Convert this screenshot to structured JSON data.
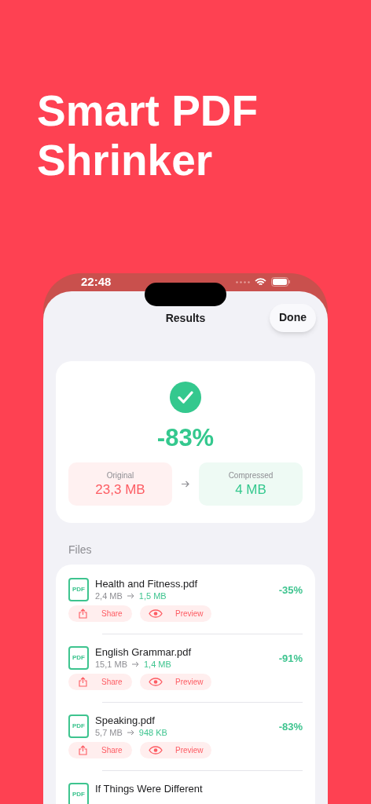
{
  "headline": "Smart PDF Shrinker",
  "status_bar": {
    "time": "22:48"
  },
  "sheet": {
    "title": "Results",
    "done_button": "Done"
  },
  "summary": {
    "success": true,
    "reduction": "-83%",
    "original": {
      "label": "Original",
      "value": "23,3 MB"
    },
    "compressed": {
      "label": "Compressed",
      "value": "4 MB"
    }
  },
  "files_header": "Files",
  "files": [
    {
      "icon_label": "PDF",
      "name": "Health and Fitness.pdf",
      "original_size": "2,4 MB",
      "compressed_size": "1,5 MB",
      "reduction": "-35%",
      "share": "Share",
      "preview": "Preview"
    },
    {
      "icon_label": "PDF",
      "name": "English Grammar.pdf",
      "original_size": "15,1 MB",
      "compressed_size": "1,4 MB",
      "reduction": "-91%",
      "share": "Share",
      "preview": "Preview"
    },
    {
      "icon_label": "PDF",
      "name": "Speaking.pdf",
      "original_size": "5,7 MB",
      "compressed_size": "948 KB",
      "reduction": "-83%",
      "share": "Share",
      "preview": "Preview"
    },
    {
      "icon_label": "PDF",
      "name": "If Things Were Different"
    }
  ]
}
